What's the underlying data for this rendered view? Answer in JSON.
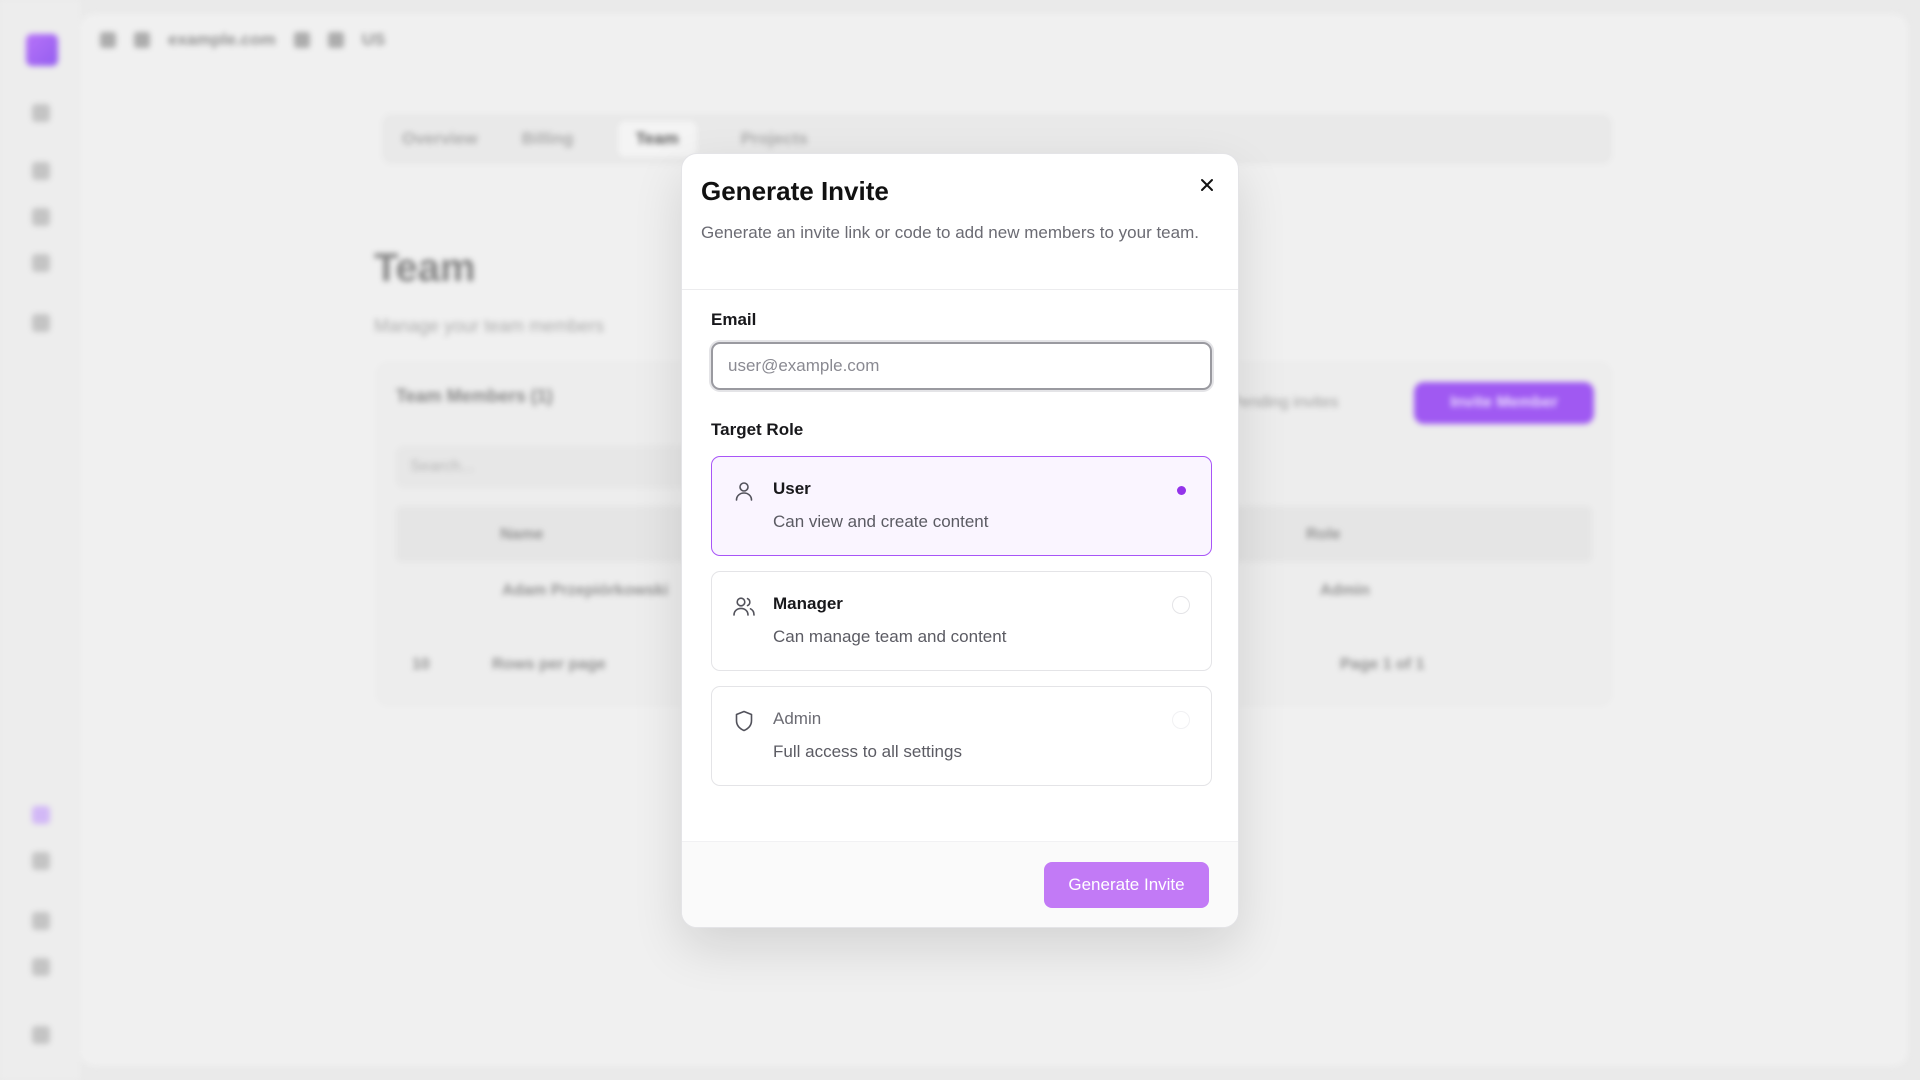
{
  "background": {
    "topbar": {
      "domain": "example.com",
      "locale": "US"
    },
    "tabs": [
      "Overview",
      "Billing",
      "Team",
      "Projects"
    ],
    "active_tab": "Team",
    "page_title": "Team",
    "page_subtitle": "Manage your team members",
    "card_title": "Team Members (1)",
    "pending_invites": "Pending invites",
    "invite_button": "Invite Member",
    "search_placeholder": "Search...",
    "table": {
      "headers": [
        "Name",
        "Role"
      ],
      "rows": [
        {
          "name": "Adam Przepiórkowski",
          "role": "Admin"
        }
      ]
    },
    "rows_per_page_label": "Rows per page",
    "rows_per_page": "10",
    "pagination": "Page 1 of 1"
  },
  "dialog": {
    "title": "Generate Invite",
    "description": "Generate an invite link or code to add new members to your team.",
    "close_icon": "close-icon",
    "email": {
      "label": "Email",
      "placeholder": "user@example.com",
      "value": ""
    },
    "target_role": {
      "label": "Target Role",
      "selected": "User",
      "options": [
        {
          "name": "User",
          "description": "Can view and create content",
          "icon": "user-icon",
          "selected": true
        },
        {
          "name": "Manager",
          "description": "Can manage team and content",
          "icon": "users-icon",
          "selected": false
        },
        {
          "name": "Admin",
          "description": "Full access to all settings",
          "icon": "shield-icon",
          "selected": false
        }
      ]
    },
    "submit_label": "Generate Invite"
  },
  "colors": {
    "accent": "#9333ea",
    "selected_border": "#a855f7",
    "selected_bg": "#faf5ff",
    "button_disabled": "#c27af6"
  }
}
